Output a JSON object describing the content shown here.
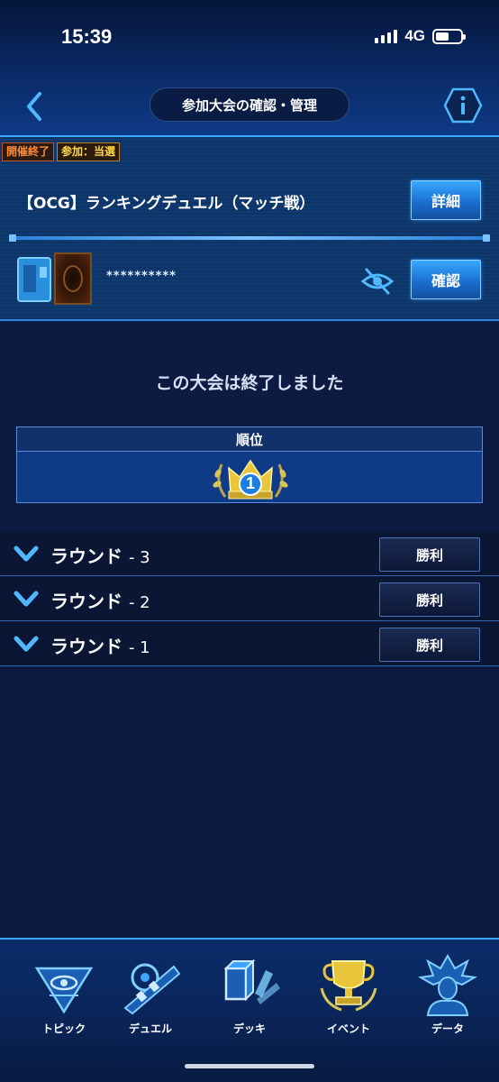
{
  "status_bar": {
    "time": "15:39",
    "network": "4G"
  },
  "header": {
    "title": "参加大会の確認・管理"
  },
  "tournament": {
    "badges": {
      "ended": "開催終了",
      "entry": "参加：当選"
    },
    "name": "【OCG】ランキングデュエル（マッチ戦）",
    "details_button": "詳細",
    "deck_name": "**********",
    "confirm_button": "確認"
  },
  "main": {
    "ended_message": "この大会は終了しました",
    "rank_header": "順位",
    "rank_value": "1"
  },
  "rounds": [
    {
      "label": "ラウンド",
      "number": "- 3",
      "result": "勝利"
    },
    {
      "label": "ラウンド",
      "number": "- 2",
      "result": "勝利"
    },
    {
      "label": "ラウンド",
      "number": "- 1",
      "result": "勝利"
    }
  ],
  "nav": [
    {
      "label": "トピック",
      "icon": "millennium-eye-icon"
    },
    {
      "label": "デュエル",
      "icon": "duel-disk-icon"
    },
    {
      "label": "デッキ",
      "icon": "deck-cards-icon"
    },
    {
      "label": "イベント",
      "icon": "trophy-icon"
    },
    {
      "label": "データ",
      "icon": "character-silhouette-icon"
    }
  ],
  "colors": {
    "accent": "#3da4ff",
    "button": "#1a6fd1",
    "ended_badge": "#ff8a3a",
    "entry_badge": "#ffd84a",
    "trophy": "#e8c53a"
  }
}
